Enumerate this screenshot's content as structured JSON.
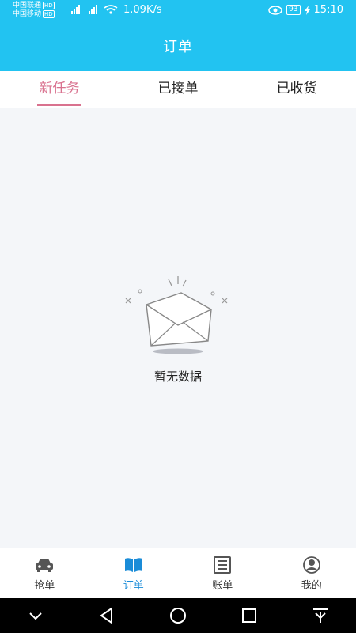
{
  "status_bar": {
    "carrier_1": "中国联通",
    "carrier_2": "中国移动",
    "hd_badge": "HD",
    "signal_1": "⁴ᴳ",
    "signal_2": "⁴ᴳ",
    "speed": "1.09K/s",
    "battery": "93",
    "time": "15:10"
  },
  "header": {
    "title": "订单"
  },
  "tabs": [
    {
      "label": "新任务",
      "active": true
    },
    {
      "label": "已接单",
      "active": false
    },
    {
      "label": "已收货",
      "active": false
    }
  ],
  "empty_state": {
    "text": "暂无数据"
  },
  "bottom_nav": [
    {
      "label": "抢单",
      "icon": "car-icon"
    },
    {
      "label": "订单",
      "icon": "book-icon",
      "active": true
    },
    {
      "label": "账单",
      "icon": "list-icon"
    },
    {
      "label": "我的",
      "icon": "user-icon"
    }
  ],
  "colors": {
    "header_bg": "#22c3f1",
    "tab_active": "#d9728f",
    "nav_active": "#1a8cd8",
    "page_bg": "#f4f6f9"
  }
}
